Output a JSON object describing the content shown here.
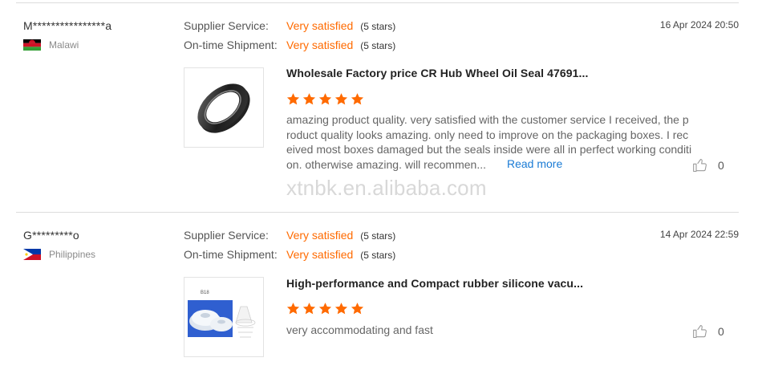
{
  "reviews": [
    {
      "buyer": "M****************a",
      "country": "Malawi",
      "flag_colors": [
        "#000000",
        "#ce1126",
        "#339e35"
      ],
      "supplier_service_label": "Supplier Service:",
      "supplier_service_value": "Very satisfied",
      "supplier_service_stars": "(5 stars)",
      "ontime_label": "On-time Shipment:",
      "ontime_value": "Very satisfied",
      "ontime_stars": "(5 stars)",
      "date": "16 Apr 2024 20:50",
      "product_title": "Wholesale Factory price CR Hub Wheel Oil Seal 47691...",
      "rating": 5,
      "comment": "amazing product quality. very satisfied with the customer service I received, the product quality looks amazing. only need to improve on the packaging boxes. I received most boxes damaged but the seals inside were all in perfect working condition. otherwise amazing. will recommen...",
      "read_more": "Read more",
      "likes": "0",
      "image_icon": "oil-seal-ring"
    },
    {
      "buyer": "G*********o",
      "country": "Philippines",
      "flag_colors": [
        "#0038a8",
        "#ce1126",
        "#ffffff",
        "#fcd116"
      ],
      "supplier_service_label": "Supplier Service:",
      "supplier_service_value": "Very satisfied",
      "supplier_service_stars": "(5 stars)",
      "ontime_label": "On-time Shipment:",
      "ontime_value": "Very satisfied",
      "ontime_stars": "(5 stars)",
      "date": "14 Apr 2024 22:59",
      "product_title": "High-performance and Compact rubber silicone vacu...",
      "rating": 5,
      "comment": "very accommodating and fast",
      "likes": "0",
      "image_icon": "silicone-vacuum-cups"
    }
  ],
  "watermark": "xtnbk.en.alibaba.com",
  "colors": {
    "accent": "#ff6a00",
    "link": "#1a7bd5",
    "star": "#ff6a00"
  }
}
